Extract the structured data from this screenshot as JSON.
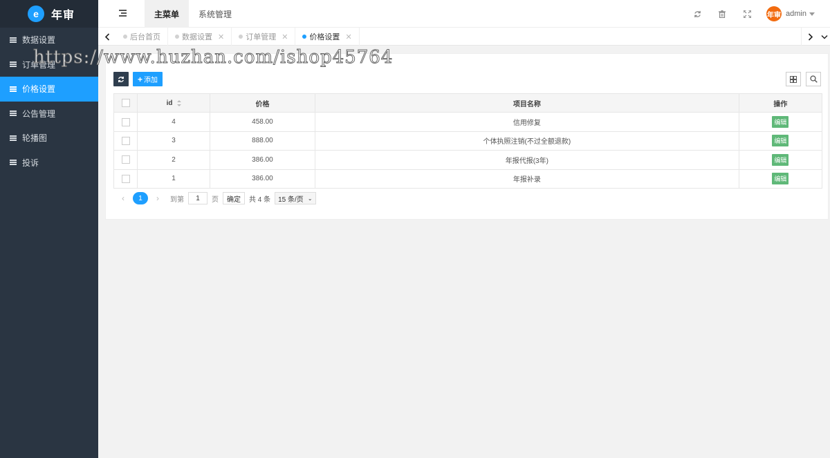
{
  "brand": {
    "name": "年审",
    "logo_letter": "e"
  },
  "sidebar": {
    "items": [
      {
        "label": "数据设置",
        "active": false
      },
      {
        "label": "订单管理",
        "active": false
      },
      {
        "label": "价格设置",
        "active": true
      },
      {
        "label": "公告管理",
        "active": false
      },
      {
        "label": "轮播图",
        "active": false
      },
      {
        "label": "投诉",
        "active": false
      }
    ]
  },
  "header": {
    "nav": [
      {
        "label": "主菜单",
        "active": true
      },
      {
        "label": "系统管理",
        "active": false
      }
    ],
    "icons": [
      "refresh-icon",
      "trash-icon",
      "fullscreen-icon"
    ],
    "user": {
      "avatar_text": "年审",
      "name": "admin"
    }
  },
  "tabs": [
    {
      "label": "后台首页",
      "active": false,
      "closable": false
    },
    {
      "label": "数据设置",
      "active": false,
      "closable": true
    },
    {
      "label": "订单管理",
      "active": false,
      "closable": true
    },
    {
      "label": "价格设置",
      "active": true,
      "closable": true
    }
  ],
  "toolbar": {
    "add_label": "添加"
  },
  "table": {
    "columns": [
      "id",
      "价格",
      "项目名称",
      "操作"
    ],
    "rows": [
      {
        "id": "4",
        "price": "458.00",
        "name": "信用修复",
        "action": "编辑"
      },
      {
        "id": "3",
        "price": "888.00",
        "name": "个体执照注销(不过全额退款)",
        "action": "编辑"
      },
      {
        "id": "2",
        "price": "386.00",
        "name": "年报代报(3年)",
        "action": "编辑"
      },
      {
        "id": "1",
        "price": "386.00",
        "name": "年报补录",
        "action": "编辑"
      }
    ]
  },
  "pager": {
    "current": "1",
    "goto_label": "到第",
    "goto_value": "1",
    "page_unit": "页",
    "confirm_label": "确定",
    "total_label": "共 4 条",
    "page_size_label": "15 条/页"
  },
  "watermark": "https://www.huzhan.com/ishop45764",
  "colors": {
    "accent": "#1e9fff",
    "sidebar_bg": "#2a3542",
    "edit_green": "#5fb878"
  }
}
